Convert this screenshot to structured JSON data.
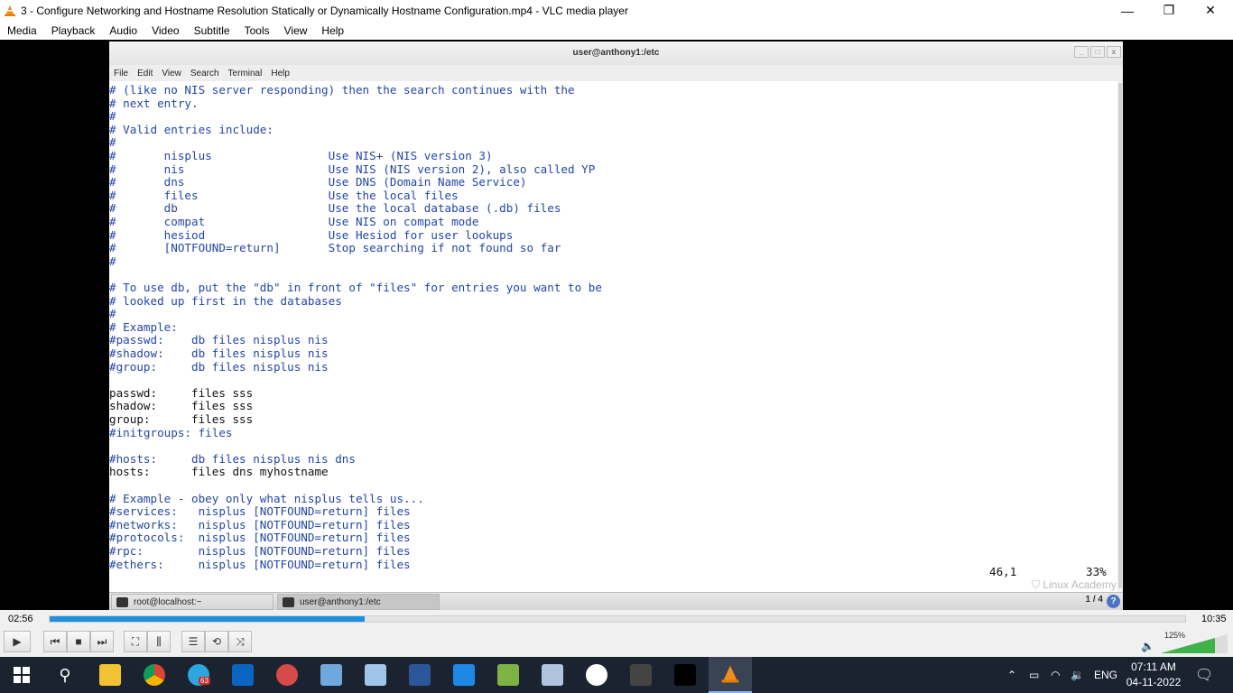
{
  "window": {
    "title": "3 - Configure Networking and Hostname Resolution Statically or Dynamically Hostname Configuration.mp4 - VLC media player",
    "minimize": "—",
    "restore": "❐",
    "close": "✕"
  },
  "vlc_menu": [
    "Media",
    "Playback",
    "Audio",
    "Video",
    "Subtitle",
    "Tools",
    "View",
    "Help"
  ],
  "terminal": {
    "title": "user@anthony1:/etc",
    "menu": [
      "File",
      "Edit",
      "View",
      "Search",
      "Terminal",
      "Help"
    ],
    "lines": [
      "# (like no NIS server responding) then the search continues with the",
      "# next entry.",
      "#",
      "# Valid entries include:",
      "#",
      "#       nisplus                 Use NIS+ (NIS version 3)",
      "#       nis                     Use NIS (NIS version 2), also called YP",
      "#       dns                     Use DNS (Domain Name Service)",
      "#       files                   Use the local files",
      "#       db                      Use the local database (.db) files",
      "#       compat                  Use NIS on compat mode",
      "#       hesiod                  Use Hesiod for user lookups",
      "#       [NOTFOUND=return]       Stop searching if not found so far",
      "#",
      "",
      "# To use db, put the \"db\" in front of \"files\" for entries you want to be",
      "# looked up first in the databases",
      "#",
      "# Example:",
      "#passwd:    db files nisplus nis",
      "#shadow:    db files nisplus nis",
      "#group:     db files nisplus nis",
      "",
      "passwd:     files sss",
      "shadow:     files sss",
      "group:      files sss",
      "#initgroups: files",
      "",
      "#hosts:     db files nisplus nis dns",
      "hosts:      files dns myhostname",
      "",
      "# Example - obey only what nisplus tells us...",
      "#services:   nisplus [NOTFOUND=return] files",
      "#networks:   nisplus [NOTFOUND=return] files",
      "#protocols:  nisplus [NOTFOUND=return] files",
      "#rpc:        nisplus [NOTFOUND=return] files",
      "#ethers:     nisplus [NOTFOUND=return] files"
    ],
    "cursor_pos": "46,1",
    "scroll_pct": "33%",
    "tasks": [
      "root@localhost:~",
      "user@anthony1:/etc"
    ],
    "pager": "1 / 4",
    "help": "?"
  },
  "watermark": "Linux Academy",
  "player": {
    "elapsed": "02:56",
    "total": "10:35",
    "progress_fraction": 0.2772,
    "volume": "125%"
  },
  "taskbar": {
    "telegram_badge": "63",
    "lang": "ENG",
    "time": "07:11 AM",
    "date": "04-11-2022"
  },
  "colors": {
    "accent": "#1e90e0",
    "comment": "#2346a8",
    "taskbar": "#1b2330"
  }
}
